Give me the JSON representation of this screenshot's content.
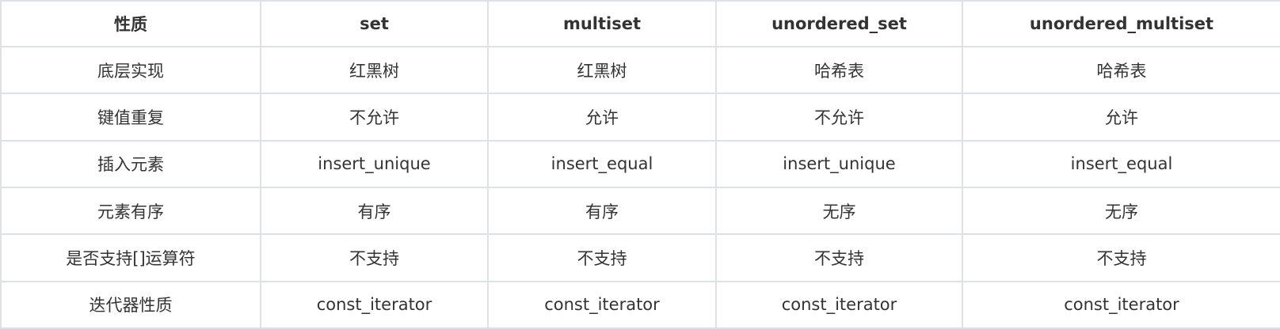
{
  "table": {
    "headers": [
      "性质",
      "set",
      "multiset",
      "unordered_set",
      "unordered_multiset"
    ],
    "rows": [
      [
        "底层实现",
        "红黑树",
        "红黑树",
        "哈希表",
        "哈希表"
      ],
      [
        "键值重复",
        "不允许",
        "允许",
        "不允许",
        "允许"
      ],
      [
        "插入元素",
        "insert_unique",
        "insert_equal",
        "insert_unique",
        "insert_equal"
      ],
      [
        "元素有序",
        "有序",
        "有序",
        "无序",
        "无序"
      ],
      [
        "是否支持[]运算符",
        "不支持",
        "不支持",
        "不支持",
        "不支持"
      ],
      [
        "迭代器性质",
        "const_iterator",
        "const_iterator",
        "const_iterator",
        "const_iterator"
      ]
    ]
  },
  "colors": {
    "border": "#dfe2e5",
    "text": "#333333",
    "background": "#ffffff"
  }
}
